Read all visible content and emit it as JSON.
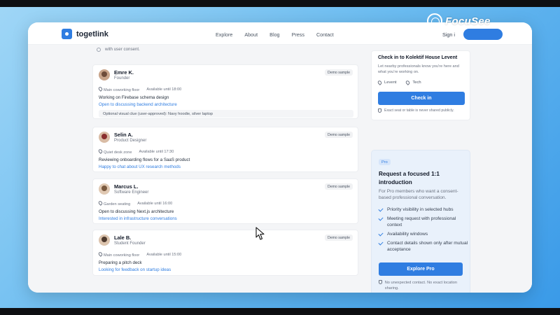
{
  "brand": {
    "name": "togetlink"
  },
  "nav": {
    "links": [
      "Explore",
      "About",
      "Blog",
      "Press",
      "Contact"
    ],
    "signin": "Sign i"
  },
  "watermark": {
    "text": "FocuSee"
  },
  "consent": {
    "text": "with user consent."
  },
  "people": [
    {
      "name": "Emre K.",
      "role": "Founder",
      "badge": "Demo sample",
      "location": "Main coworking floor",
      "availability": "Available until 18:00",
      "status": "Working on Firebase schema design",
      "pitch": "Open to discussing backend architecture",
      "clue": "Optional visual clue (user-approved): Navy hoodie, silver laptop"
    },
    {
      "name": "Selin A.",
      "role": "Product Designer",
      "badge": "Demo sample",
      "location": "Quiet desk zone",
      "availability": "Available until 17:30",
      "status": "Reviewing onboarding flows for a SaaS product",
      "pitch": "Happy to chat about UX research methods"
    },
    {
      "name": "Marcus L.",
      "role": "Software Engineer",
      "badge": "Demo sample",
      "location": "Garden seating",
      "availability": "Available until 16:00",
      "status": "Open to discussing Next.js architecture",
      "pitch": "Interested in infrastructure conversations"
    },
    {
      "name": "Lale B.",
      "role": "Student Founder",
      "badge": "Demo sample",
      "location": "Main coworking floor",
      "availability": "Available until 15:00",
      "status": "Preparing a pitch deck",
      "pitch": "Looking for feedback on startup ideas"
    }
  ],
  "checkin": {
    "title": "Check in to Kolektif House Levent",
    "desc": "Let nearby professionals know you're here and what you're working on.",
    "tags": [
      "Levent",
      "Tech"
    ],
    "button": "Check in",
    "privacy": "Exact seat or table is never shared publicly."
  },
  "pro": {
    "badge": "Pro",
    "title": "Request a focused 1:1 introduction",
    "desc": "For Pro members who want a consent-based professional conversation.",
    "features": [
      "Priority visibility in selected hubs",
      "Meeting request with professional context",
      "Availability windows",
      "Contact details shown only after mutual acceptance"
    ],
    "button": "Explore Pro",
    "note": "No unexpected contact. No exact location sharing."
  },
  "colors": {
    "accent": "#2f7de1",
    "page_bg": "#f4f5f7",
    "pro_bg": "#e9f1fb"
  }
}
